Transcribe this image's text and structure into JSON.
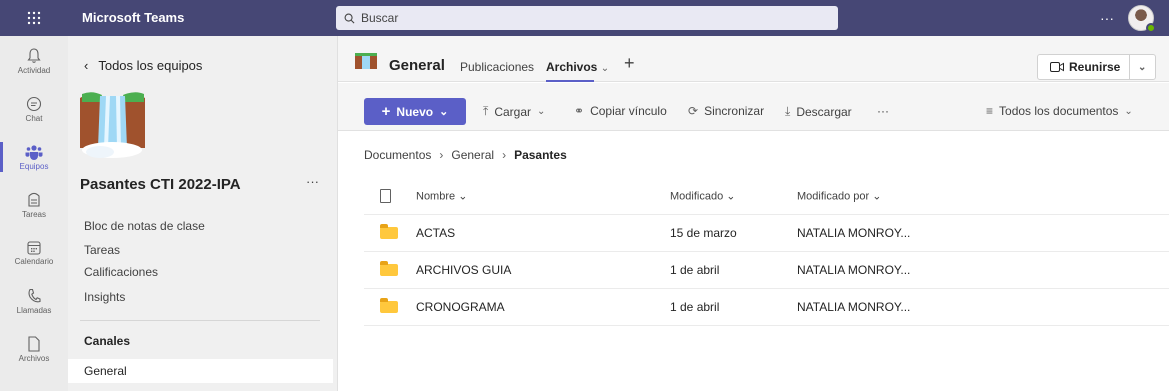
{
  "topbar": {
    "app_name": "Microsoft Teams",
    "search_placeholder": "Buscar",
    "more_label": "···"
  },
  "rail": {
    "items": [
      {
        "label": "Actividad",
        "icon": "bell-icon"
      },
      {
        "label": "Chat",
        "icon": "chat-icon"
      },
      {
        "label": "Equipos",
        "icon": "teams-icon"
      },
      {
        "label": "Tareas",
        "icon": "assignments-icon"
      },
      {
        "label": "Calendario",
        "icon": "calendar-icon"
      },
      {
        "label": "Llamadas",
        "icon": "phone-icon"
      },
      {
        "label": "Archivos",
        "icon": "file-icon"
      }
    ],
    "active_item": "Equipos"
  },
  "team_panel": {
    "back_label": "Todos los equipos",
    "team_name": "Pasantes CTI 2022-IPA",
    "more_label": "···",
    "links": [
      "Bloc de notas de clase",
      "Tareas",
      "Calificaciones",
      "Insights"
    ],
    "channels_title": "Canales",
    "channels": [
      "General"
    ]
  },
  "header": {
    "channel_title": "General",
    "tabs": [
      {
        "label": "Publicaciones"
      },
      {
        "label": "Archivos"
      }
    ],
    "active_tab": "Archivos",
    "add_tab": "+",
    "meet_label": "Reunirse"
  },
  "toolbar": {
    "new_label": "Nuevo",
    "upload_label": "Cargar",
    "copy_link_label": "Copiar vínculo",
    "sync_label": "Sincronizar",
    "download_label": "Descargar",
    "more_label": "···",
    "view_label": "Todos los documentos"
  },
  "breadcrumb": [
    "Documentos",
    "General",
    "Pasantes"
  ],
  "files": {
    "columns": {
      "name": "Nombre",
      "modified": "Modificado",
      "modified_by": "Modificado por"
    },
    "rows": [
      {
        "name": "ACTAS",
        "modified": "15 de marzo",
        "modified_by": "NATALIA MONROY..."
      },
      {
        "name": "ARCHIVOS GUIA",
        "modified": "1 de abril",
        "modified_by": "NATALIA MONROY..."
      },
      {
        "name": "CRONOGRAMA",
        "modified": "1 de abril",
        "modified_by": "NATALIA MONROY..."
      }
    ]
  },
  "colors": {
    "topbar": "#464775",
    "accent": "#5b5fc7",
    "folder": "#ffc83d",
    "presence": "#6bb700"
  }
}
